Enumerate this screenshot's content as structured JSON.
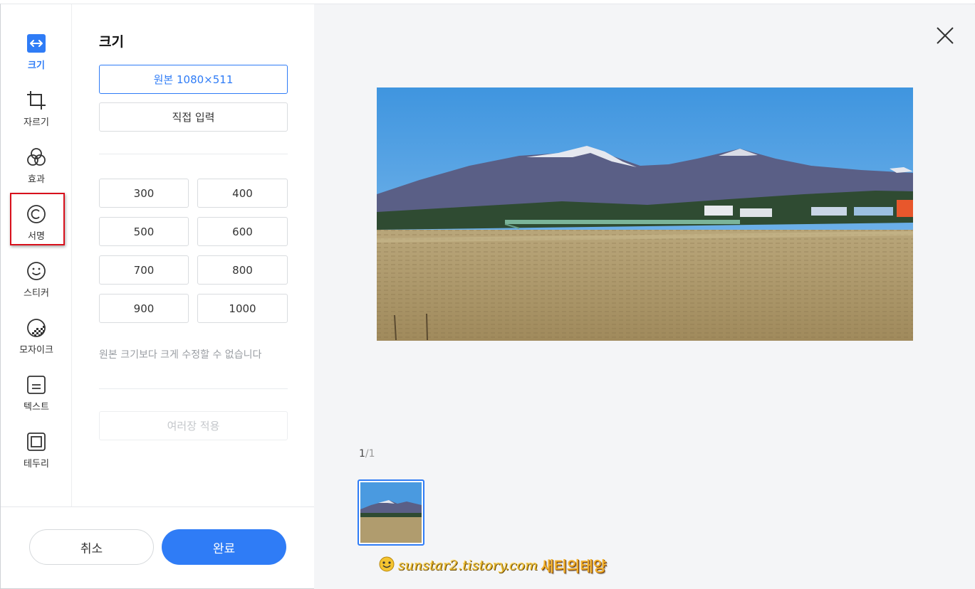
{
  "tools": [
    {
      "label": "크기",
      "icon": "resize-icon",
      "active": true
    },
    {
      "label": "자르기",
      "icon": "crop-icon"
    },
    {
      "label": "효과",
      "icon": "effects-icon"
    },
    {
      "label": "서명",
      "icon": "copyright-icon"
    },
    {
      "label": "스티커",
      "icon": "smiley-icon"
    },
    {
      "label": "모자이크",
      "icon": "mosaic-icon"
    },
    {
      "label": "텍스트",
      "icon": "text-box-icon"
    },
    {
      "label": "테두리",
      "icon": "border-frame-icon"
    }
  ],
  "panel": {
    "title": "크기",
    "original_label": "원본 1080×511",
    "custom_label": "직접 입력",
    "presets": [
      "300",
      "400",
      "500",
      "600",
      "700",
      "800",
      "900",
      "1000"
    ],
    "note": "원본 크기보다 크게 수정할 수 없습니다",
    "apply_all_label": "여러장 적용"
  },
  "footer": {
    "cancel_label": "취소",
    "done_label": "완료"
  },
  "preview": {
    "page_current": "1",
    "page_total": "/1",
    "watermark_url": "sunstar2.tistory.com",
    "watermark_name": "새티의태양"
  },
  "colors": {
    "accent": "#2f7cf6",
    "highlight_box": "#d8101c",
    "preview_bg": "#f4f5f7"
  }
}
